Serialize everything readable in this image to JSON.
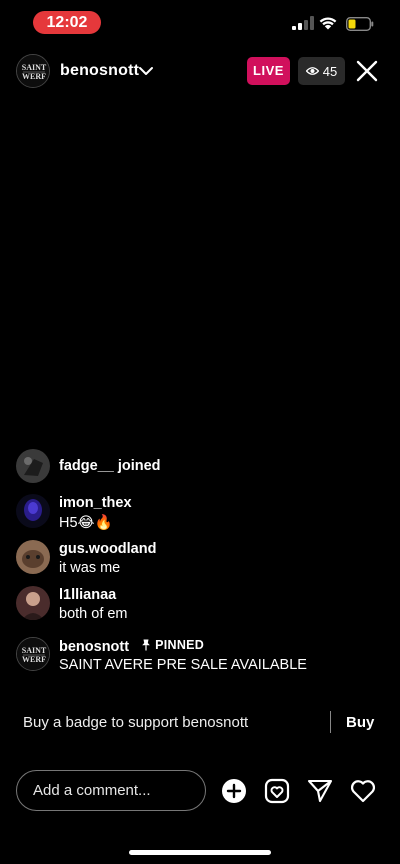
{
  "status_bar": {
    "time": "12:02",
    "time_pill_color": "#e5383b",
    "battery_color": "#f5d90a"
  },
  "header": {
    "host_username": "benosnott",
    "live_label": "LIVE",
    "live_color": "#d1105c",
    "viewer_count": "45",
    "icons": [
      "chevron-down-icon",
      "eye-icon",
      "close-icon"
    ]
  },
  "comments": [
    {
      "username": "fadge__",
      "suffix": "joined",
      "text": ""
    },
    {
      "username": "imon_thex",
      "text": "H5😂🔥"
    },
    {
      "username": "gus.woodland",
      "text": "it was me"
    },
    {
      "username": "l1llianaa",
      "text": "both of em"
    },
    {
      "username": "benosnott",
      "tag": "PINNED",
      "text": "SAINT AVERE PRE SALE AVAILABLE"
    }
  ],
  "badge_bar": {
    "text": "Buy a badge to support benosnott",
    "button": "Buy"
  },
  "bottom_bar": {
    "comment_placeholder": "Add a comment...",
    "icons": [
      "add-circle-icon",
      "question-box-icon",
      "send-icon",
      "heart-icon"
    ]
  },
  "avatar_logo_text": {
    "line1": "SAINT",
    "line2": "WERF"
  }
}
